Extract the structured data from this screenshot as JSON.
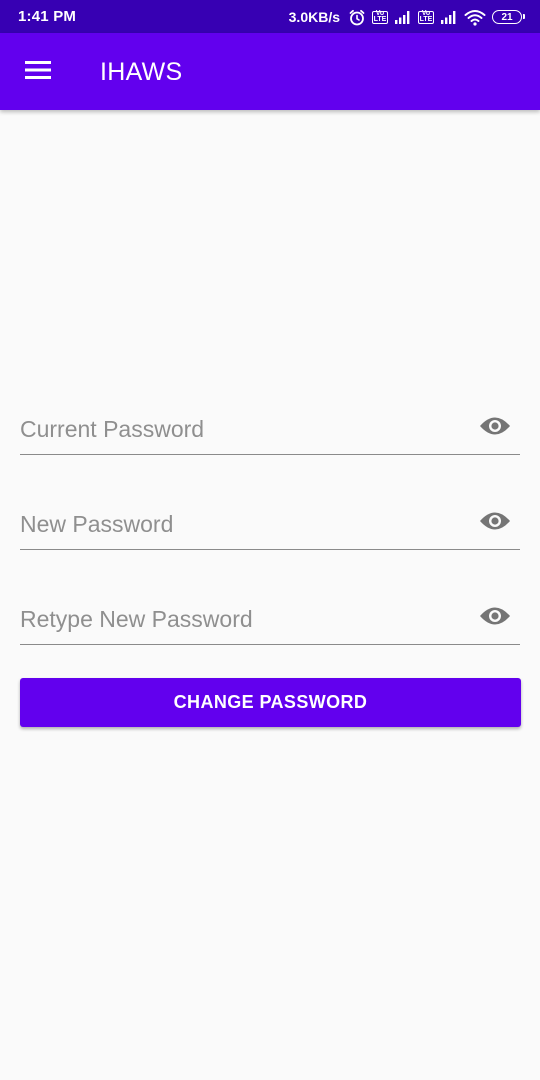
{
  "status_bar": {
    "time": "1:41 PM",
    "net_speed": "3.0KB/s",
    "alarm_icon": "alarm-clock-icon",
    "volte_label": "Vo LTE",
    "signal_icon": "cellular-signal-icon",
    "wifi_icon": "wifi-icon",
    "battery_level": "21"
  },
  "app_bar": {
    "title": "IHAWS",
    "menu_icon": "hamburger-menu-icon"
  },
  "form": {
    "current_password": {
      "placeholder": "Current Password",
      "value": ""
    },
    "new_password": {
      "placeholder": "New Password",
      "value": ""
    },
    "retype_password": {
      "placeholder": "Retype New Password",
      "value": ""
    },
    "toggle_icon": "eye-icon",
    "submit_label": "CHANGE PASSWORD"
  },
  "colors": {
    "status_bar": "#3700b3",
    "primary": "#6200ee",
    "background": "#fafafa",
    "hint_text": "#8f8f8f",
    "icon_gray": "#757575"
  }
}
